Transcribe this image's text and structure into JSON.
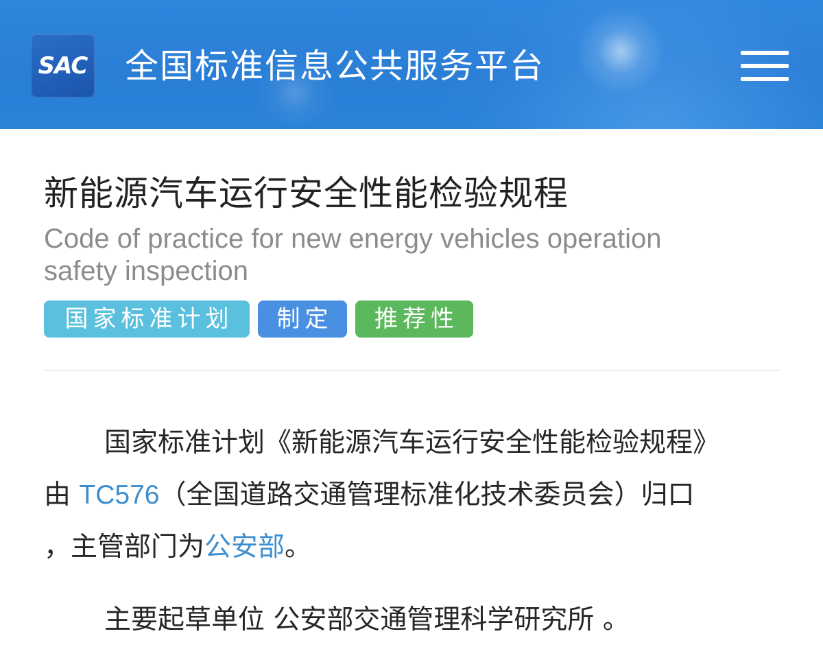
{
  "header": {
    "logo_text": "SAC",
    "site_title": "全国标准信息公共服务平台",
    "menu_icon": "hamburger-menu-icon",
    "background_color": "#2b82d9"
  },
  "standard": {
    "title": "新能源汽车运行安全性能检验规程",
    "title_en": "Code of practice for new energy vehicles operation safety inspection",
    "tags": [
      {
        "label": "国家标准计划",
        "color": "#5bc0de"
      },
      {
        "label": "制定",
        "color": "#4a90e2"
      },
      {
        "label": "推荐性",
        "color": "#5cb85c"
      }
    ]
  },
  "description": {
    "line1": "国家标准计划《新能源汽车运行安全性能检验规程》",
    "line2_prefix": "由 ",
    "tc_link": "TC576",
    "line2_suffix": "（全国道路交通管理标准化技术委员会）归口",
    "line3_prefix": "，主管部门为",
    "dept_link": "公安部",
    "line3_suffix": "。",
    "drafting_unit": "主要起草单位 公安部交通管理科学研究所 。"
  },
  "colors": {
    "link": "#3d8ecf",
    "subtitle": "#8c8c8c"
  }
}
